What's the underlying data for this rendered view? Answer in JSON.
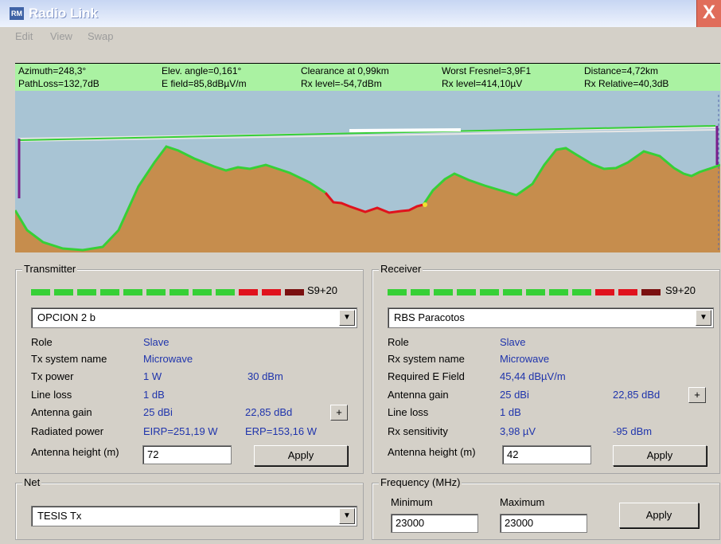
{
  "window": {
    "title": "Radio Link",
    "app_icon_label": "RM",
    "close_label": "X"
  },
  "menu": {
    "items": [
      "Edit",
      "View",
      "Swap"
    ]
  },
  "info": {
    "row1": [
      "Azimuth=248,3°",
      "Elev. angle=0,161°",
      "Clearance at 0,99km",
      "Worst Fresnel=3,9F1",
      "Distance=4,72km"
    ],
    "row2": [
      "PathLoss=132,7dB",
      "E field=85,8dBµV/m",
      "Rx level=-54,7dBm",
      "Rx level=414,10µV",
      "Rx Relative=40,3dB"
    ]
  },
  "transmitter": {
    "title": "Transmitter",
    "meter_label": "S9+20",
    "site": "OPCION 2 b",
    "role_label": "Role",
    "role_value": "Slave",
    "system_label": "Tx system name",
    "system_value": "Microwave",
    "power_label": "Tx power",
    "power_w": "1 W",
    "power_dbm": "30 dBm",
    "loss_label": "Line loss",
    "loss_value": "1 dB",
    "gain_label": "Antenna gain",
    "gain_dbi": "25 dBi",
    "gain_dbd": "22,85 dBd",
    "radiated_label": "Radiated power",
    "eirp": "EIRP=251,19 W",
    "erp": "ERP=153,16 W",
    "height_label": "Antenna height (m)",
    "height_value": "72",
    "apply_label": "Apply",
    "plus_label": "+"
  },
  "receiver": {
    "title": "Receiver",
    "meter_label": "S9+20",
    "site": "RBS Paracotos",
    "role_label": "Role",
    "role_value": "Slave",
    "system_label": "Rx system name",
    "system_value": "Microwave",
    "field_label": "Required E Field",
    "field_value": "45,44 dBµV/m",
    "gain_label": "Antenna gain",
    "gain_dbi": "25 dBi",
    "gain_dbd": "22,85 dBd",
    "loss_label": "Line loss",
    "loss_value": "1 dB",
    "sens_label": "Rx sensitivity",
    "sens_uv": "3,98 µV",
    "sens_dbm": "-95 dBm",
    "height_label": "Antenna height (m)",
    "height_value": "42",
    "apply_label": "Apply",
    "plus_label": "+"
  },
  "net": {
    "title": "Net",
    "value": "TESIS Tx"
  },
  "frequency": {
    "title": "Frequency (MHz)",
    "min_label": "Minimum",
    "min_value": "23000",
    "max_label": "Maximum",
    "max_value": "23000",
    "apply_label": "Apply"
  },
  "colors": {
    "terrain": "#c68d4d",
    "sky": "#a8c4d4",
    "terrain_edge": "#36d036",
    "obstructed_edge": "#e0121d",
    "info_bar": "#aaf2a2"
  }
}
